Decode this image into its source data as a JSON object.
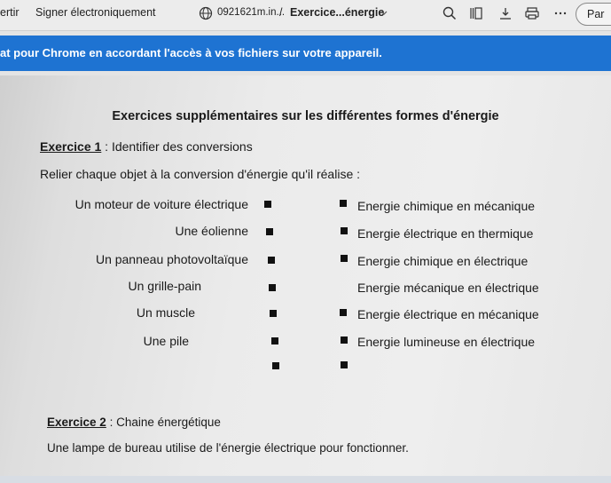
{
  "toolbar": {
    "partial_left": "ertir",
    "sign_label": "Signer électroniquement",
    "filename": "0921621m.in...",
    "separator": "/",
    "doc_name": "Exercice...énergie",
    "partial_right": "Par"
  },
  "banner": {
    "text": "at pour Chrome en accordant l'accès à vos fichiers sur votre appareil."
  },
  "document": {
    "title": "Exercices supplémentaires sur les différentes formes d'énergie",
    "ex1_label": "Exercice 1",
    "ex1_rest": " : Identifier des conversions",
    "instruction": "Relier chaque objet à la conversion d'énergie qu'il réalise :",
    "objects": [
      "Un moteur de voiture électrique",
      "Une éolienne",
      "Un panneau photovoltaïque",
      "Un grille-pain",
      "Un muscle",
      "Une pile"
    ],
    "conversions": [
      "Energie chimique en mécanique",
      "Energie électrique en thermique",
      "Energie chimique en électrique",
      "Energie mécanique en électrique",
      "Energie électrique en mécanique",
      "Energie lumineuse en électrique"
    ],
    "ex2_label": "Exercice 2",
    "ex2_rest": " : Chaine énergétique",
    "ex2_text": "Une lampe de bureau utilise de l'énergie électrique pour fonctionner."
  }
}
